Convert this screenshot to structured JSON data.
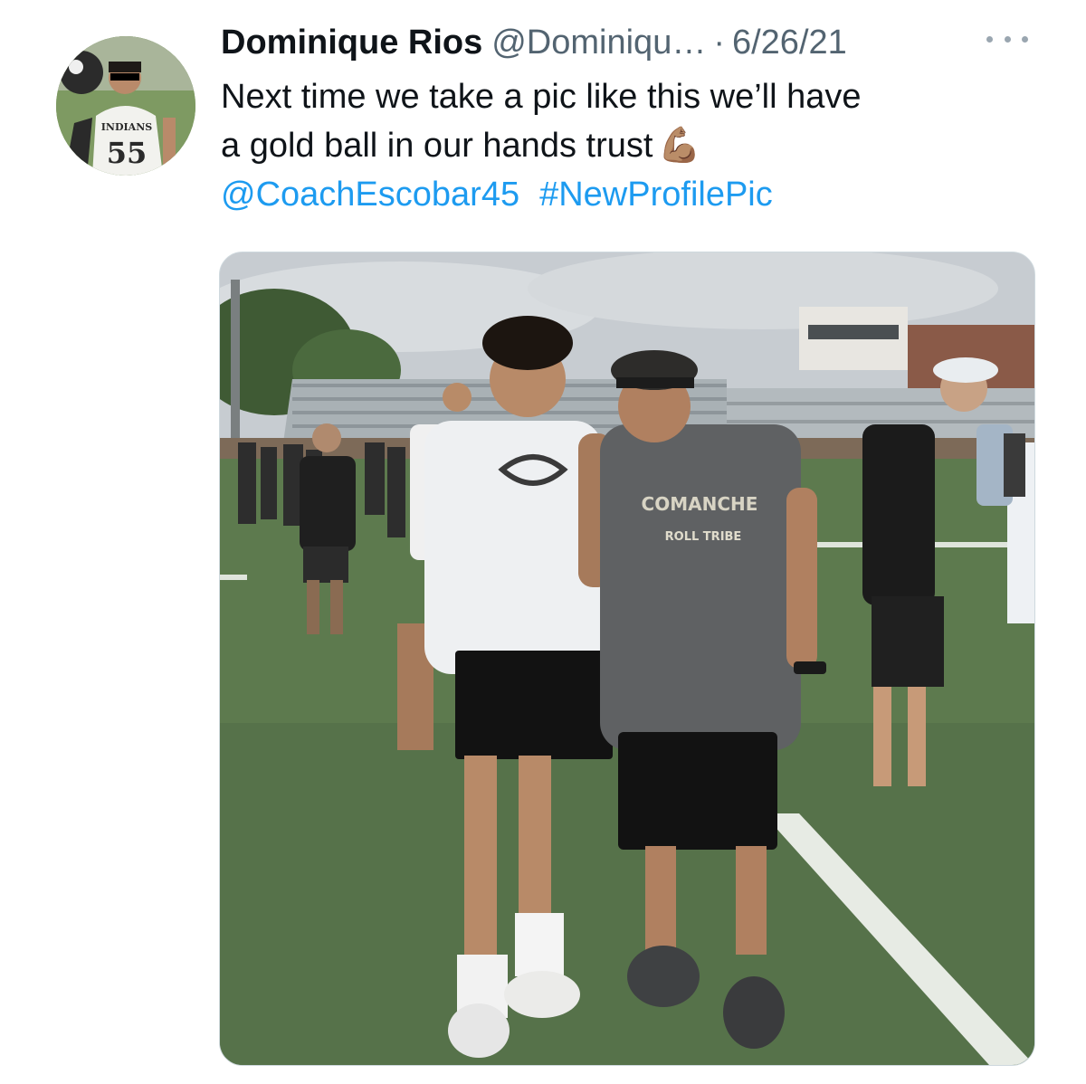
{
  "tweet": {
    "author_name": "Dominique Rios",
    "author_handle": "@Dominiqu…",
    "separator": "·",
    "date": "6/26/21",
    "text_line1": "Next time we take a pic like this we’ll have",
    "text_line2": "a gold ball in our hands trust",
    "emoji": "💪🏽",
    "mention": "@CoachEscobar45",
    "hashtag": "#NewProfilePic"
  },
  "avatar": {
    "jersey_team": "INDIANS",
    "jersey_number": "55"
  },
  "photo": {
    "shirt_text_1": "COMANCHE",
    "shirt_text_2": "ROLL TRIBE"
  },
  "icons": {
    "more": "more-horizontal-icon",
    "muscle": "flexed-biceps-emoji"
  },
  "colors": {
    "link": "#1d9bf0",
    "secondary_text": "#536471",
    "turf": "#5d7a4e"
  }
}
